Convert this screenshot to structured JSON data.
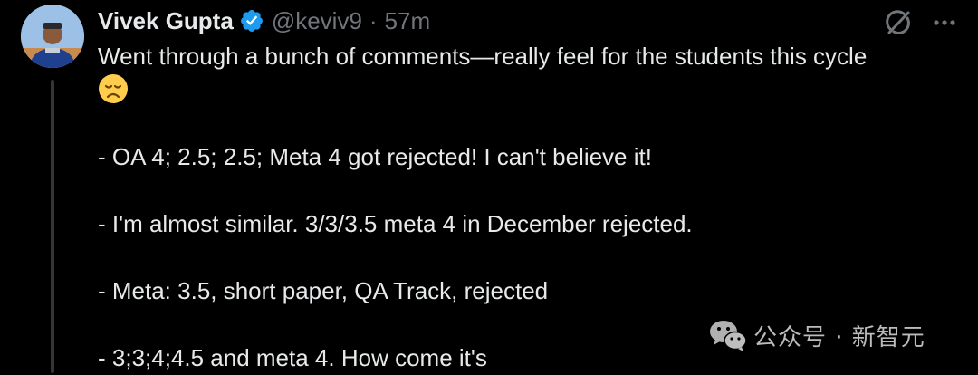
{
  "author": {
    "display_name": "Vivek Gupta",
    "handle": "@keviv9",
    "separator": "·",
    "time": "57m",
    "verified_icon": "verified-badge-icon",
    "avatar_icon": "avatar"
  },
  "actions": {
    "grok_icon": "grok-icon",
    "more_icon": "more-options-icon"
  },
  "body": {
    "lines": [
      "Went through a bunch of comments—really feel for the students this cycle",
      "",
      "",
      "- OA 4; 2.5; 2.5; Meta 4 got rejected! I can't believe it!",
      "",
      "- I'm almost similar. 3/3/3.5 meta 4 in December rejected.",
      "",
      "- Meta: 3.5, short paper, QA Track, rejected",
      "",
      "- 3;3;4;4.5 and meta 4. How come it's"
    ],
    "emoji": "disappointed-face-emoji"
  },
  "watermark": {
    "text": "公众号 · 新智元",
    "logo_icon": "wechat-logo-icon"
  },
  "colors": {
    "background": "#000000",
    "text": "#e7e9ea",
    "secondary": "#71767b",
    "verified": "#1d9bf0",
    "thread_line": "#333639"
  }
}
